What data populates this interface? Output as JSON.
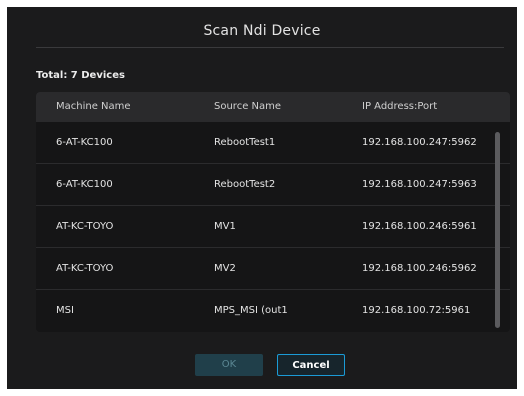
{
  "dialog": {
    "title": "Scan Ndi Device",
    "total_label": "Total: 7 Devices"
  },
  "table": {
    "columns": [
      "Machine Name",
      "Source Name",
      "IP Address:Port"
    ],
    "rows": [
      {
        "machine": "6-AT-KC100",
        "source": "RebootTest1",
        "ip": "192.168.100.247:5962"
      },
      {
        "machine": "6-AT-KC100",
        "source": "RebootTest2",
        "ip": "192.168.100.247:5963"
      },
      {
        "machine": "AT-KC-TOYO",
        "source": "MV1",
        "ip": "192.168.100.246:5961"
      },
      {
        "machine": "AT-KC-TOYO",
        "source": "MV2",
        "ip": "192.168.100.246:5962"
      },
      {
        "machine": "MSI",
        "source": "MPS_MSI (out1",
        "ip": "192.168.100.72:5961"
      }
    ]
  },
  "buttons": {
    "ok_label": "OK",
    "cancel_label": "Cancel"
  },
  "colors": {
    "dialog_bg": "#1b1b1c",
    "header_bg": "#2a2a2c",
    "accent": "#1b9bd6",
    "ok_bg": "#203f4a"
  }
}
